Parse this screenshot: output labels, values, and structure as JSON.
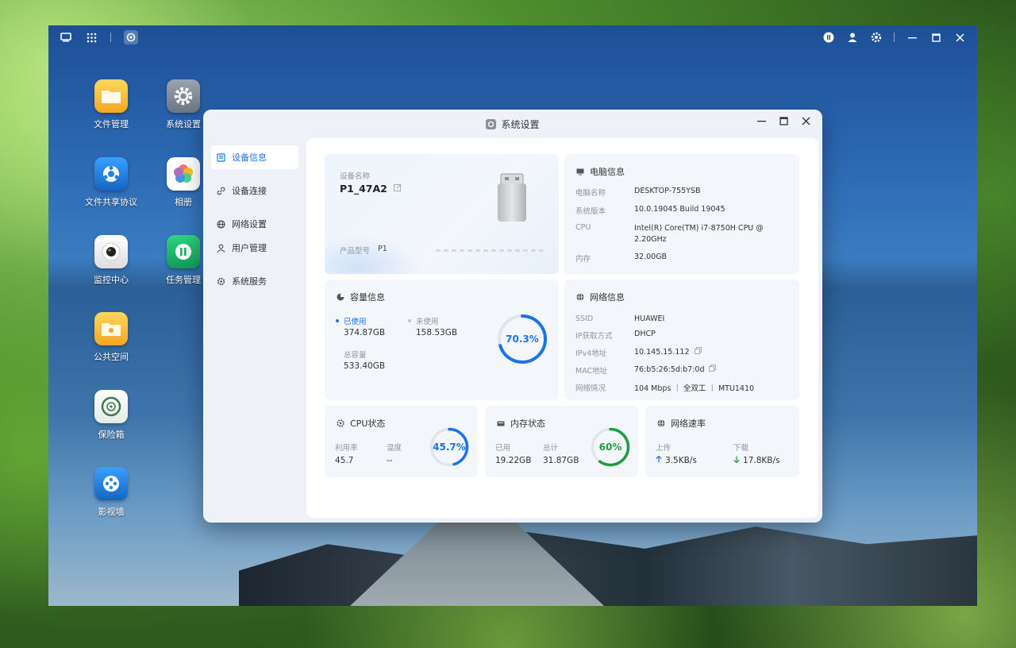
{
  "topbar": {
    "icons": [
      "desktop-icon",
      "apps-grid-icon",
      "settings-app-icon",
      "info-icon",
      "user-icon",
      "gear-icon",
      "minimize-icon",
      "maximize-icon",
      "close-icon"
    ]
  },
  "desktop_apps": [
    {
      "label": "文件管理",
      "icon": "folder-icon",
      "color": "#f5a623"
    },
    {
      "label": "系统设置",
      "icon": "gear-icon",
      "color": "#7f8a96"
    },
    {
      "label": "文件共享协议",
      "icon": "share-icon",
      "color": "#1e88e5"
    },
    {
      "label": "相册",
      "icon": "photos-icon",
      "color": "#ffffff"
    },
    {
      "label": "监控中心",
      "icon": "camera-icon",
      "color": "#f0f0f0"
    },
    {
      "label": "任务管理",
      "icon": "task-icon",
      "color": "#16b56a"
    },
    {
      "label": "公共空间",
      "icon": "public-folder-icon",
      "color": "#f5a623"
    },
    {
      "label": "保险箱",
      "icon": "safe-icon",
      "color": "#eef2ee"
    },
    {
      "label": "影视墙",
      "icon": "film-icon",
      "color": "#1e88e5"
    }
  ],
  "window": {
    "title": "系统设置",
    "sidebar": [
      {
        "label": "设备信息",
        "icon": "device-icon",
        "active": true
      },
      {
        "label": "设备连接",
        "icon": "link-icon",
        "active": false
      },
      {
        "label": "网络设置",
        "icon": "globe-icon",
        "active": false
      },
      {
        "label": "用户管理",
        "icon": "user-icon",
        "active": false
      },
      {
        "label": "系统服务",
        "icon": "service-icon",
        "active": false
      }
    ],
    "device": {
      "name_label": "设备名称",
      "name": "P1_47A2",
      "model_label": "产品型号",
      "model": "P1"
    },
    "pc": {
      "title": "电脑信息",
      "rows": [
        {
          "k": "电脑名称",
          "v": "DESKTOP-755YSB"
        },
        {
          "k": "系统版本",
          "v": "10.0.19045 Build 19045"
        },
        {
          "k": "CPU",
          "v": "Intel(R) Core(TM) i7-8750H CPU @ 2.20GHz"
        },
        {
          "k": "内存",
          "v": "32.00GB"
        }
      ]
    },
    "capacity": {
      "title": "容量信息",
      "used_label": "已使用",
      "used": "374.87GB",
      "free_label": "未使用",
      "free": "158.53GB",
      "total_label": "总容量",
      "total": "533.40GB",
      "percent_text": "70.3%",
      "percent": 70.3,
      "color": "#1a73e8"
    },
    "network": {
      "title": "网络信息",
      "rows": [
        {
          "k": "SSID",
          "v": "HUAWEI"
        },
        {
          "k": "IP获取方式",
          "v": "DHCP"
        },
        {
          "k": "IPv4地址",
          "v": "10.145.15.112"
        },
        {
          "k": "MAC地址",
          "v": "76:b5:26:5d:b7:0d"
        },
        {
          "k": "网络情况",
          "v": "104 Mbps ｜ 全双工 ｜ MTU1410"
        }
      ]
    },
    "cpu": {
      "title": "CPU状态",
      "usage_label": "利用率",
      "usage": "45.7",
      "temp_label": "温度",
      "temp": "--",
      "percent_text": "45.7%",
      "percent": 45.7,
      "color": "#1a73e8"
    },
    "memory": {
      "title": "内存状态",
      "used_label": "已用",
      "used": "19.22GB",
      "total_label": "总计",
      "total": "31.87GB",
      "percent_text": "60%",
      "percent": 60,
      "color": "#1e9e3e"
    },
    "speed": {
      "title": "网络速率",
      "up_label": "上传",
      "up": "3.5KB/s",
      "down_label": "下载",
      "down": "17.8KB/s"
    }
  }
}
